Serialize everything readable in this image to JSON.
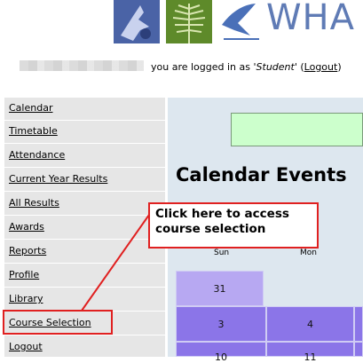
{
  "header": {
    "brand_text": "WHA",
    "logos": [
      "bird-logo-icon",
      "fern-logo-icon",
      "crane-logo-icon"
    ]
  },
  "login": {
    "prefix": "you are logged in as",
    "user": "'Student'",
    "logout_label": "Logout"
  },
  "sidebar": {
    "items": [
      {
        "label": "Calendar"
      },
      {
        "label": "Timetable"
      },
      {
        "label": "Attendance"
      },
      {
        "label": "Current Year Results"
      },
      {
        "label": "All Results"
      },
      {
        "label": "Awards"
      },
      {
        "label": "Reports"
      },
      {
        "label": "Profile"
      },
      {
        "label": "Library"
      },
      {
        "label": "Course Selection"
      },
      {
        "label": "Logout"
      }
    ]
  },
  "main": {
    "title": "Calendar Events",
    "days": [
      "Sun",
      "Mon"
    ],
    "dates": [
      "31",
      "3",
      "4",
      "10",
      "11"
    ]
  },
  "annotation": {
    "callout_line1": "Click here to access",
    "callout_line2": "course selection"
  },
  "colors": {
    "accent_red": "#e02020",
    "calendar_purple": "#8b75e8",
    "sidebar_bg": "#e6e6e6"
  }
}
